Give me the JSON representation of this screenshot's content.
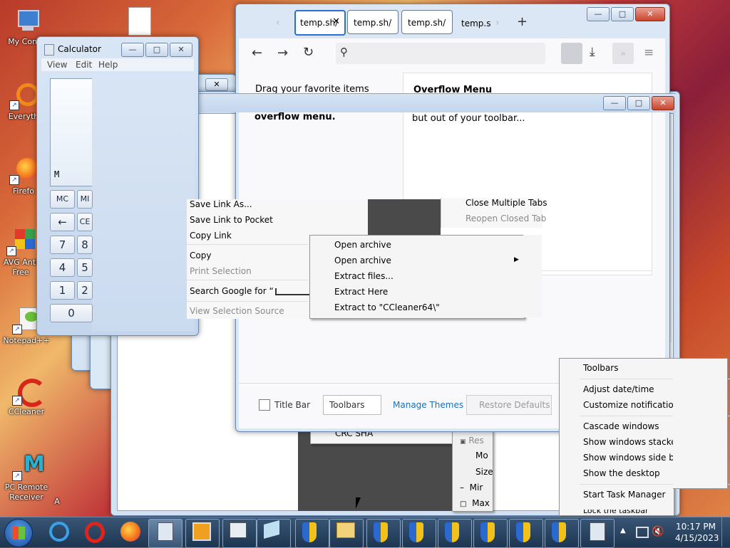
{
  "desktop": {
    "icons": [
      {
        "label": "My Comp",
        "icon": "computer-icon"
      },
      {
        "label": "Everyth",
        "icon": "everything-search-icon"
      },
      {
        "label": "Firefo",
        "icon": "firefox-icon"
      },
      {
        "label": "AVG Anti Free",
        "icon": "avg-antivirus-icon"
      },
      {
        "label": "Notepad++",
        "icon": "notepadpp-icon"
      },
      {
        "label": "CCleaner",
        "icon": "ccleaner-icon"
      },
      {
        "label": "PC Remote Receiver",
        "icon": "pc-remote-icon"
      },
      {
        "label": "A",
        "icon": "document-icon"
      }
    ]
  },
  "calculator": {
    "title": "Calculator",
    "menu": [
      "View",
      "Edit",
      "Help"
    ],
    "memory_indicator": "M",
    "buttons": [
      "MC",
      "MI",
      "←",
      "CE",
      "7",
      "8",
      "4",
      "5",
      "1",
      "2",
      "0"
    ]
  },
  "firefox": {
    "tabs": [
      "temp.sh/",
      "temp.sh/",
      "temp.sh/",
      "temp.s"
    ],
    "new_tab": "+",
    "customize_left_line1": "Drag your favorite items",
    "customize_left_line2": "overflow menu.",
    "overflow_title": "Overflow Menu",
    "overflow_text": "but out of your toolbar...",
    "footer": {
      "title_bar": "Title Bar",
      "toolbars": "Toolbars",
      "manage_themes": "Manage Themes",
      "restore_defaults": "Restore Defaults"
    }
  },
  "context_menu": {
    "items": [
      "Save Link As...",
      "Save Link to Pocket",
      "Copy Link",
      "Copy",
      "Print Selection",
      "Search Google for “",
      "View Selection Source"
    ],
    "disabled": [
      "Print Selection",
      "View Selection Source"
    ]
  },
  "tab_menu": {
    "items": [
      "Close Multiple Tabs",
      "Reopen Closed Tab"
    ]
  },
  "archive_menu": {
    "items": [
      "Open archive",
      "Open archive",
      "Extract files...",
      "Extract Here",
      "Extract to \"CCleaner64\\\""
    ]
  },
  "behind_menu": {
    "item": "CRC SHA"
  },
  "system_menu": {
    "items": [
      "Res",
      "Mo",
      "Size",
      "Mir",
      "Max"
    ]
  },
  "taskbar_menu": {
    "items": [
      "Toolbars",
      "Adjust date/time",
      "Customize notification icons",
      "Cascade windows",
      "Show windows stacked",
      "Show windows side by side",
      "Show the desktop",
      "Start Task Manager",
      "Lock the taskbar"
    ]
  },
  "taskbar": {
    "time": "10:17 PM",
    "date": "4/15/2023"
  },
  "colors": {
    "taskbar": "#1d3550",
    "firefox_link": "#1a6fb4",
    "menu_bg": "#f5f5f5"
  }
}
